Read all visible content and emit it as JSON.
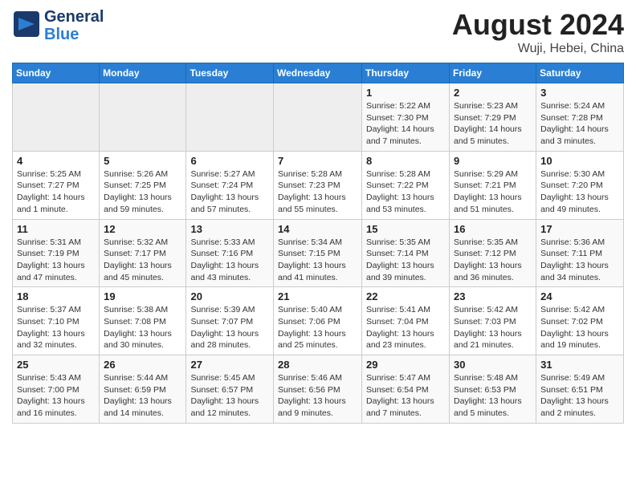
{
  "header": {
    "logo_general": "General",
    "logo_blue": "Blue",
    "month_title": "August 2024",
    "location": "Wuji, Hebei, China"
  },
  "weekdays": [
    "Sunday",
    "Monday",
    "Tuesday",
    "Wednesday",
    "Thursday",
    "Friday",
    "Saturday"
  ],
  "weeks": [
    [
      {
        "day": "",
        "empty": true
      },
      {
        "day": "",
        "empty": true
      },
      {
        "day": "",
        "empty": true
      },
      {
        "day": "",
        "empty": true
      },
      {
        "day": "1",
        "sunrise": "5:22 AM",
        "sunset": "7:30 PM",
        "daylight": "14 hours and 7 minutes."
      },
      {
        "day": "2",
        "sunrise": "5:23 AM",
        "sunset": "7:29 PM",
        "daylight": "14 hours and 5 minutes."
      },
      {
        "day": "3",
        "sunrise": "5:24 AM",
        "sunset": "7:28 PM",
        "daylight": "14 hours and 3 minutes."
      }
    ],
    [
      {
        "day": "4",
        "sunrise": "5:25 AM",
        "sunset": "7:27 PM",
        "daylight": "14 hours and 1 minute."
      },
      {
        "day": "5",
        "sunrise": "5:26 AM",
        "sunset": "7:25 PM",
        "daylight": "13 hours and 59 minutes."
      },
      {
        "day": "6",
        "sunrise": "5:27 AM",
        "sunset": "7:24 PM",
        "daylight": "13 hours and 57 minutes."
      },
      {
        "day": "7",
        "sunrise": "5:28 AM",
        "sunset": "7:23 PM",
        "daylight": "13 hours and 55 minutes."
      },
      {
        "day": "8",
        "sunrise": "5:28 AM",
        "sunset": "7:22 PM",
        "daylight": "13 hours and 53 minutes."
      },
      {
        "day": "9",
        "sunrise": "5:29 AM",
        "sunset": "7:21 PM",
        "daylight": "13 hours and 51 minutes."
      },
      {
        "day": "10",
        "sunrise": "5:30 AM",
        "sunset": "7:20 PM",
        "daylight": "13 hours and 49 minutes."
      }
    ],
    [
      {
        "day": "11",
        "sunrise": "5:31 AM",
        "sunset": "7:19 PM",
        "daylight": "13 hours and 47 minutes."
      },
      {
        "day": "12",
        "sunrise": "5:32 AM",
        "sunset": "7:17 PM",
        "daylight": "13 hours and 45 minutes."
      },
      {
        "day": "13",
        "sunrise": "5:33 AM",
        "sunset": "7:16 PM",
        "daylight": "13 hours and 43 minutes."
      },
      {
        "day": "14",
        "sunrise": "5:34 AM",
        "sunset": "7:15 PM",
        "daylight": "13 hours and 41 minutes."
      },
      {
        "day": "15",
        "sunrise": "5:35 AM",
        "sunset": "7:14 PM",
        "daylight": "13 hours and 39 minutes."
      },
      {
        "day": "16",
        "sunrise": "5:35 AM",
        "sunset": "7:12 PM",
        "daylight": "13 hours and 36 minutes."
      },
      {
        "day": "17",
        "sunrise": "5:36 AM",
        "sunset": "7:11 PM",
        "daylight": "13 hours and 34 minutes."
      }
    ],
    [
      {
        "day": "18",
        "sunrise": "5:37 AM",
        "sunset": "7:10 PM",
        "daylight": "13 hours and 32 minutes."
      },
      {
        "day": "19",
        "sunrise": "5:38 AM",
        "sunset": "7:08 PM",
        "daylight": "13 hours and 30 minutes."
      },
      {
        "day": "20",
        "sunrise": "5:39 AM",
        "sunset": "7:07 PM",
        "daylight": "13 hours and 28 minutes."
      },
      {
        "day": "21",
        "sunrise": "5:40 AM",
        "sunset": "7:06 PM",
        "daylight": "13 hours and 25 minutes."
      },
      {
        "day": "22",
        "sunrise": "5:41 AM",
        "sunset": "7:04 PM",
        "daylight": "13 hours and 23 minutes."
      },
      {
        "day": "23",
        "sunrise": "5:42 AM",
        "sunset": "7:03 PM",
        "daylight": "13 hours and 21 minutes."
      },
      {
        "day": "24",
        "sunrise": "5:42 AM",
        "sunset": "7:02 PM",
        "daylight": "13 hours and 19 minutes."
      }
    ],
    [
      {
        "day": "25",
        "sunrise": "5:43 AM",
        "sunset": "7:00 PM",
        "daylight": "13 hours and 16 minutes."
      },
      {
        "day": "26",
        "sunrise": "5:44 AM",
        "sunset": "6:59 PM",
        "daylight": "13 hours and 14 minutes."
      },
      {
        "day": "27",
        "sunrise": "5:45 AM",
        "sunset": "6:57 PM",
        "daylight": "13 hours and 12 minutes."
      },
      {
        "day": "28",
        "sunrise": "5:46 AM",
        "sunset": "6:56 PM",
        "daylight": "13 hours and 9 minutes."
      },
      {
        "day": "29",
        "sunrise": "5:47 AM",
        "sunset": "6:54 PM",
        "daylight": "13 hours and 7 minutes."
      },
      {
        "day": "30",
        "sunrise": "5:48 AM",
        "sunset": "6:53 PM",
        "daylight": "13 hours and 5 minutes."
      },
      {
        "day": "31",
        "sunrise": "5:49 AM",
        "sunset": "6:51 PM",
        "daylight": "13 hours and 2 minutes."
      }
    ]
  ]
}
